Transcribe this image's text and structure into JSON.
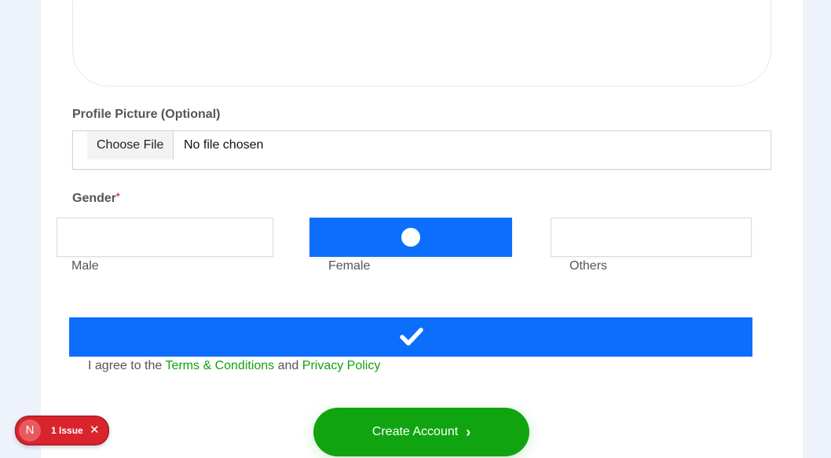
{
  "profile_picture": {
    "label": "Profile Picture (Optional)",
    "button_label": "Choose File",
    "status": "No file chosen"
  },
  "gender": {
    "label": "Gender",
    "required_mark": "*",
    "options": [
      {
        "label": "Male",
        "selected": false
      },
      {
        "label": "Female",
        "selected": true
      },
      {
        "label": "Others",
        "selected": false
      }
    ]
  },
  "terms": {
    "checked": true,
    "prefix": "I agree to the ",
    "terms_link": "Terms & Conditions",
    "and": " and ",
    "privacy_link": "Privacy Policy"
  },
  "create_button": {
    "label": "Create Account",
    "icon": "chevron-right-icon"
  },
  "issue_badge": {
    "avatar_letter": "N",
    "text": "1 Issue",
    "close_icon": "close-icon"
  },
  "colors": {
    "primary": "#0d6efd",
    "success": "#10a510",
    "link": "#13a10e",
    "danger": "#d9232d"
  }
}
